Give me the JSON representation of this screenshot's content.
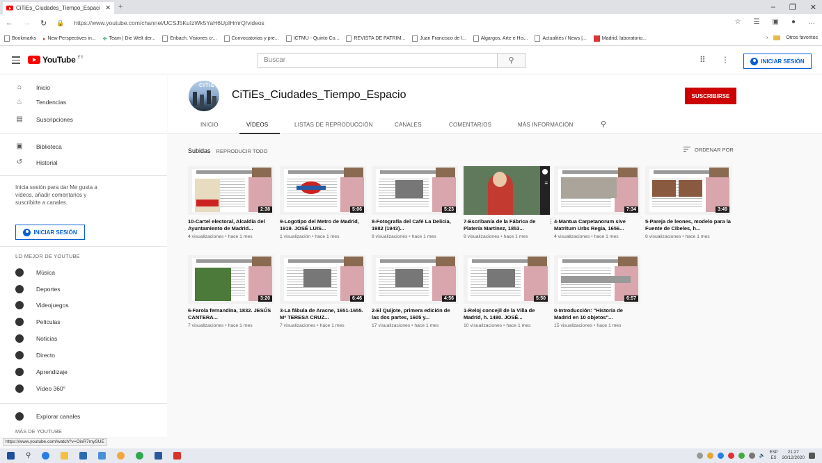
{
  "browser": {
    "tab_title": "CiTiEs_Ciudades_Tiempo_Espaci",
    "url": "https://www.youtube.com/channel/UCSJ5KuIzWk5YaH6UpIHmrQ/videos",
    "bookmarks": [
      "Bookmarks",
      "New Perspectives in...",
      "Team | Die Welt der...",
      "Enbach. Visiones cr...",
      "Convocatorias y pre...",
      "ICTMU - Quinto Co...",
      "REVISTA DE PATRIM...",
      "Juan Francisco de l...",
      "Algargos, Arte e His...",
      "Actualités / News |...",
      "Madrid, laboratorio..."
    ],
    "other_favorites": "Otros favoritos",
    "status_url": "https://www.youtube.com/watch?v=OisR7mySUE"
  },
  "youtube": {
    "logo_text": "YouTube",
    "logo_sup": "ES",
    "search_placeholder": "Buscar",
    "signin_label": "INICIAR SESIÓN"
  },
  "sidebar": {
    "main": [
      {
        "label": "Inicio",
        "icon": "home-icon"
      },
      {
        "label": "Tendencias",
        "icon": "trending-icon"
      },
      {
        "label": "Suscripciones",
        "icon": "subscriptions-icon"
      }
    ],
    "library": [
      {
        "label": "Biblioteca",
        "icon": "library-icon"
      },
      {
        "label": "Historial",
        "icon": "history-icon"
      }
    ],
    "signin_text": "Inicia sesión para dar Me gusta a vídeos, añadir comentarios y suscribirte a canales.",
    "signin_label": "INICIAR SESIÓN",
    "best_title": "LO MEJOR DE YOUTUBE",
    "best": [
      "Música",
      "Deportes",
      "Videojuegos",
      "Películas",
      "Noticias",
      "Directo",
      "Aprendizaje",
      "Vídeo 360°"
    ],
    "explore": "Explorar canales",
    "more": "MÁS DE YOUTUBE"
  },
  "channel": {
    "avatar_text": "CITIE",
    "name": "CiTiEs_Ciudades_Tiempo_Espacio",
    "subscribe": "SUSCRIBIRSE",
    "tabs": [
      "INICIO",
      "VÍDEOS",
      "LISTAS DE REPRODUCCIÓN",
      "CANALES",
      "COMENTARIOS",
      "MÁS INFORMACIÓN"
    ]
  },
  "content": {
    "uploads": "Subidas",
    "play_all": "REPRODUCIR TODO",
    "sort_by": "ORDENAR POR",
    "videos": [
      {
        "title": "10-Cartel electoral, Alcaldía del Ayuntamiento de Madrid...",
        "duration": "2:38",
        "meta": "4 visualizaciones • hace 1 mes"
      },
      {
        "title": "9-Logotipo del Metro de Madrid, 1919. JOSÉ LUIS...",
        "duration": "5:06",
        "meta": "1 visualización • hace 1 mes"
      },
      {
        "title": "8-Fotografía del Café La Delicia, 1982 (1943)...",
        "duration": "5:23",
        "meta": "8 visualizaciones • hace 1 mes"
      },
      {
        "title": "7-Escribanía de la Fábrica de Platería Martínez, 1853...",
        "duration": "",
        "meta": "9 visualizaciones • hace 1 mes"
      },
      {
        "title": "4-Mantua Carpetanorum sive Matritum Urbs Regia, 1656...",
        "duration": "7:34",
        "meta": "4 visualizaciones • hace 1 mes"
      },
      {
        "title": "5-Pareja de leones, modelo para la Fuente de Cibeles, h...",
        "duration": "3:49",
        "meta": "8 visualizaciones • hace 1 mes"
      },
      {
        "title": "6-Farola fernandina, 1832. JESÚS CANTERA...",
        "duration": "3:20",
        "meta": "7 visualizaciones • hace 1 mes"
      },
      {
        "title": "3-La fábula de Aracne, 1651-1655. Mª TERESA CRUZ...",
        "duration": "6:46",
        "meta": "7 visualizaciones • hace 1 mes"
      },
      {
        "title": "2-El Quijote, primera edición de las dos partes, 1605 y...",
        "duration": "4:56",
        "meta": "17 visualizaciones • hace 1 mes"
      },
      {
        "title": "1-Reloj concejil de la Villa de Madrid, h. 1480. JOSÉ...",
        "duration": "5:50",
        "meta": "10 visualizaciones • hace 1 mes"
      },
      {
        "title": "0-Introducción: \"Historia de Madrid en 10 objetos\"...",
        "duration": "6:57",
        "meta": "15 visualizaciones • hace 1 mes"
      }
    ]
  },
  "taskbar": {
    "lang_top": "ESP",
    "lang_bottom": "ES",
    "time": "21:27",
    "date": "30/12/2020"
  }
}
